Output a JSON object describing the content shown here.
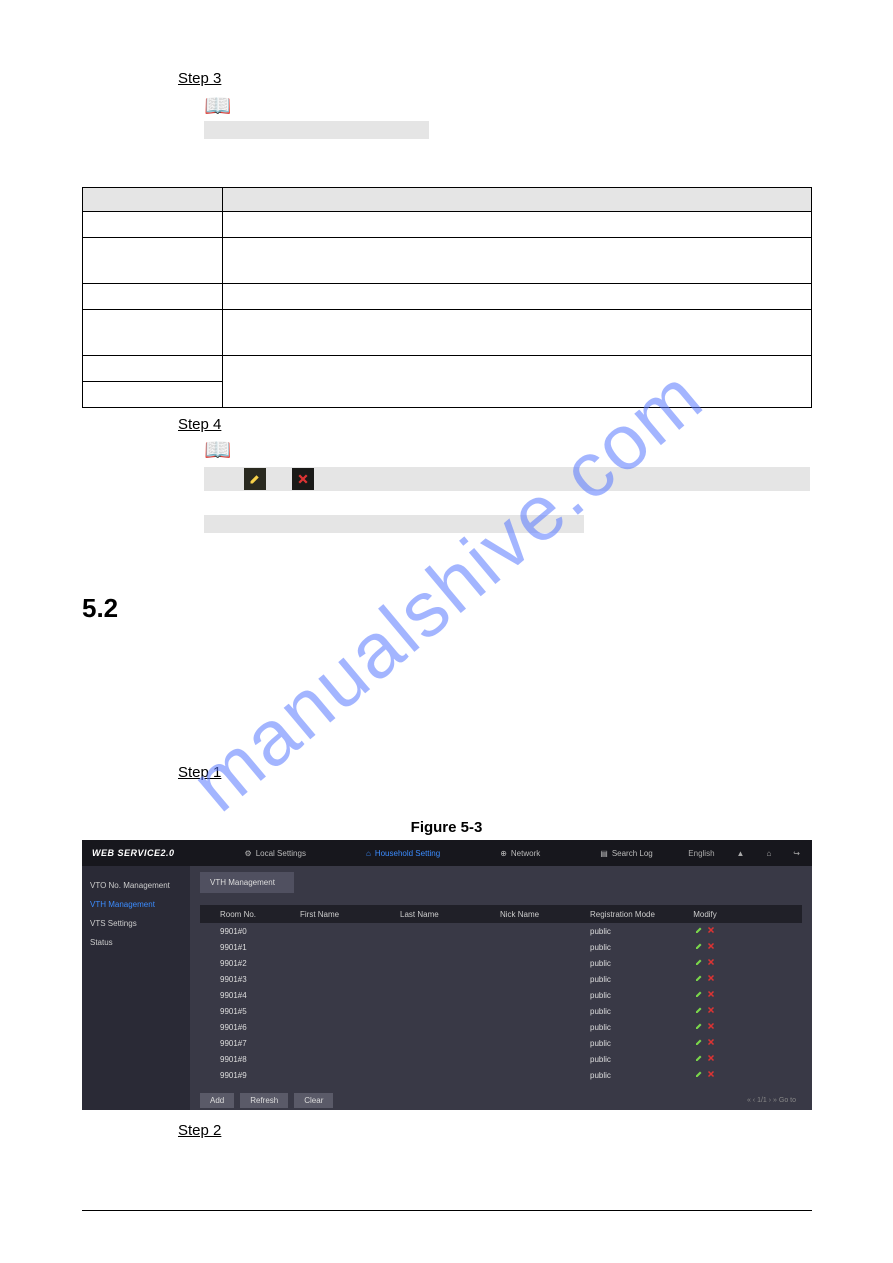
{
  "watermark": "manualshive.com",
  "steps": {
    "step3": "Step 3",
    "step4": "Step 4",
    "step1": "Step 1",
    "step2": "Step 2"
  },
  "section": "5.2",
  "figure_caption": "Figure 5-3",
  "icons": {
    "book": "📖"
  },
  "screenshot": {
    "logo": "WEB SERVICE2.0",
    "nav": {
      "local": "Local Settings",
      "household": "Household Setting",
      "network": "Network",
      "search": "Search Log"
    },
    "language": "English",
    "sidebar": {
      "vto": "VTO No. Management",
      "vth": "VTH Management",
      "vts": "VTS Settings",
      "status": "Status"
    },
    "tab": "VTH Management",
    "columns": {
      "room": "Room No.",
      "first": "First Name",
      "last": "Last Name",
      "nick": "Nick Name",
      "reg": "Registration Mode",
      "mod": "Modify"
    },
    "rows": [
      {
        "room": "9901#0",
        "reg": "public"
      },
      {
        "room": "9901#1",
        "reg": "public"
      },
      {
        "room": "9901#2",
        "reg": "public"
      },
      {
        "room": "9901#3",
        "reg": "public"
      },
      {
        "room": "9901#4",
        "reg": "public"
      },
      {
        "room": "9901#5",
        "reg": "public"
      },
      {
        "room": "9901#6",
        "reg": "public"
      },
      {
        "room": "9901#7",
        "reg": "public"
      },
      {
        "room": "9901#8",
        "reg": "public"
      },
      {
        "room": "9901#9",
        "reg": "public"
      }
    ],
    "buttons": {
      "add": "Add",
      "refresh": "Refresh",
      "clear": "Clear"
    },
    "pager": "« ‹ 1/1 › » Go to"
  }
}
